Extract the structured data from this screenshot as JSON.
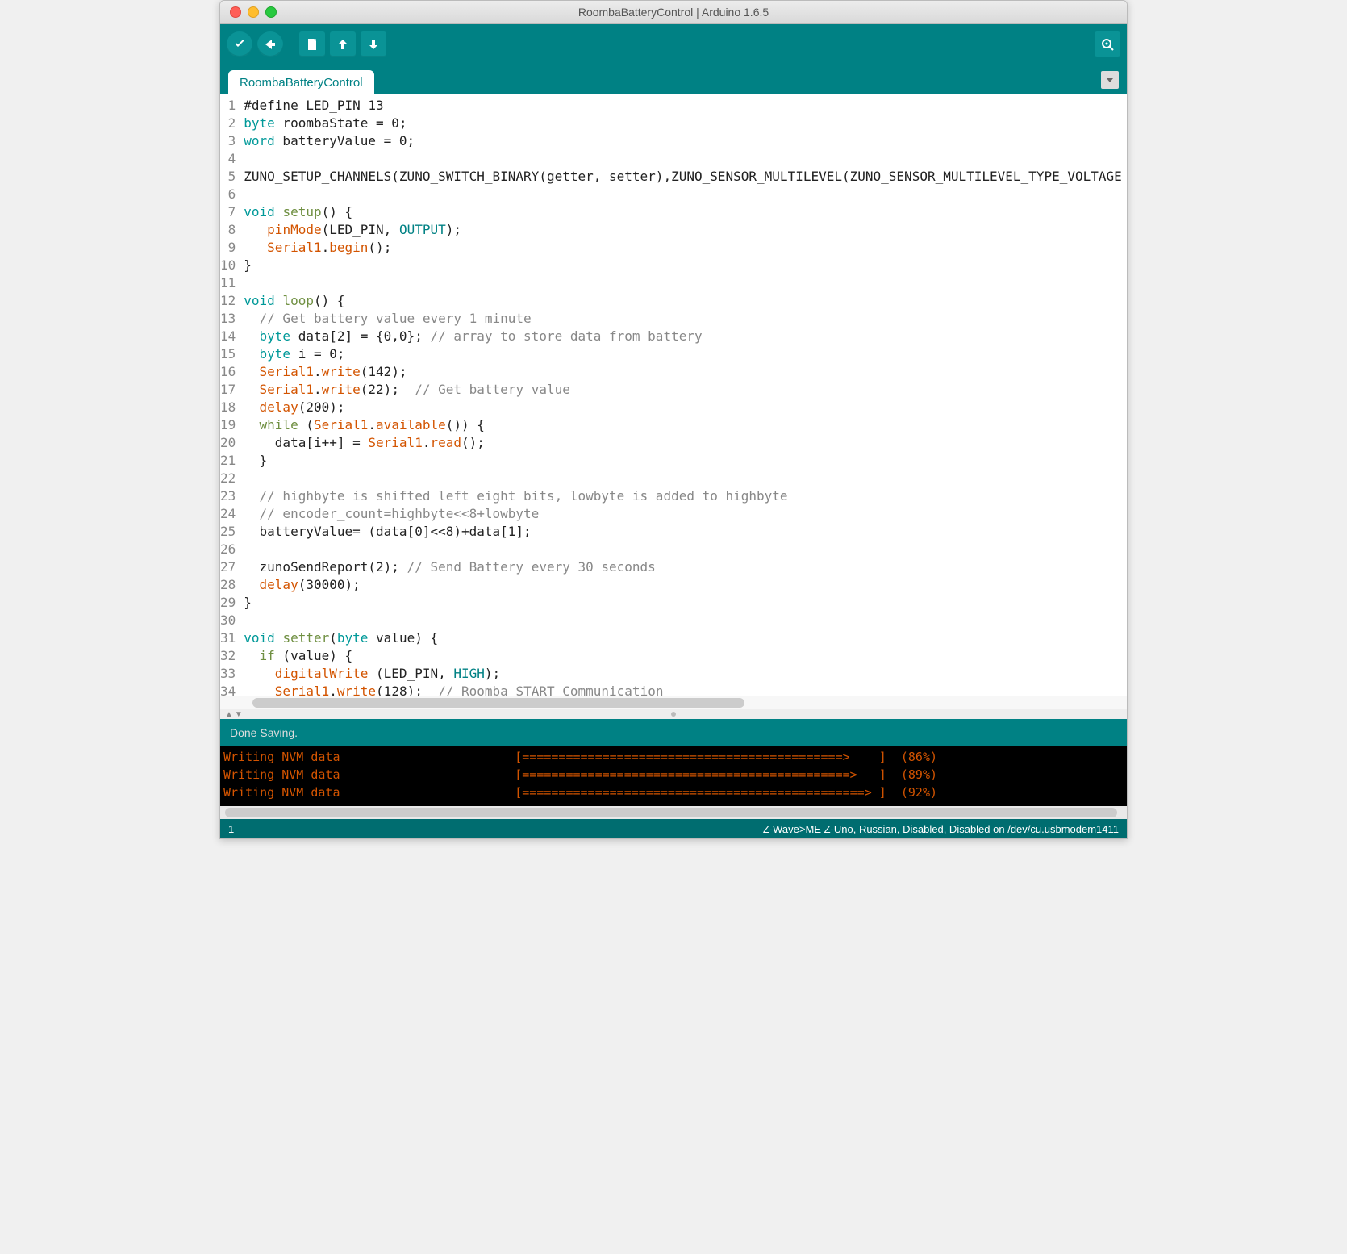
{
  "window": {
    "title": "RoombaBatteryControl | Arduino 1.6.5"
  },
  "tab": {
    "name": "RoombaBatteryControl"
  },
  "status": {
    "message": "Done Saving."
  },
  "footer": {
    "line": "1",
    "board": "Z-Wave>ME Z-Uno, Russian, Disabled, Disabled on /dev/cu.usbmodem1411"
  },
  "code_lines": [
    {
      "n": 1,
      "tokens": [
        [
          "#define LED_PIN 13",
          ""
        ]
      ]
    },
    {
      "n": 2,
      "tokens": [
        [
          "byte",
          "kw-teal"
        ],
        [
          " roombaState = 0;",
          ""
        ]
      ]
    },
    {
      "n": 3,
      "tokens": [
        [
          "word",
          "kw-teal"
        ],
        [
          " batteryValue = 0;",
          ""
        ]
      ]
    },
    {
      "n": 4,
      "tokens": [
        [
          "",
          ""
        ]
      ]
    },
    {
      "n": 5,
      "tokens": [
        [
          "ZUNO_SETUP_CHANNELS(ZUNO_SWITCH_BINARY(getter, setter),ZUNO_SENSOR_MULTILEVEL(ZUNO_SENSOR_MULTILEVEL_TYPE_VOLTAGE",
          ""
        ]
      ]
    },
    {
      "n": 6,
      "tokens": [
        [
          "",
          ""
        ]
      ]
    },
    {
      "n": 7,
      "tokens": [
        [
          "void",
          "kw-teal"
        ],
        [
          " ",
          ""
        ],
        [
          "setup",
          "kw-green"
        ],
        [
          "() {",
          ""
        ]
      ]
    },
    {
      "n": 8,
      "tokens": [
        [
          "   ",
          ""
        ],
        [
          "pinMode",
          "kw-orange"
        ],
        [
          "(LED_PIN, ",
          ""
        ],
        [
          "OUTPUT",
          "const"
        ],
        [
          ");",
          ""
        ]
      ]
    },
    {
      "n": 9,
      "tokens": [
        [
          "   ",
          ""
        ],
        [
          "Serial1",
          "kw-orange"
        ],
        [
          ".",
          ""
        ],
        [
          "begin",
          "kw-orange"
        ],
        [
          "();",
          ""
        ]
      ]
    },
    {
      "n": 10,
      "tokens": [
        [
          "}",
          ""
        ]
      ]
    },
    {
      "n": 11,
      "tokens": [
        [
          "",
          ""
        ]
      ]
    },
    {
      "n": 12,
      "tokens": [
        [
          "void",
          "kw-teal"
        ],
        [
          " ",
          ""
        ],
        [
          "loop",
          "kw-green"
        ],
        [
          "() {",
          ""
        ]
      ]
    },
    {
      "n": 13,
      "tokens": [
        [
          "  ",
          ""
        ],
        [
          "// Get battery value every 1 minute",
          "comment"
        ]
      ]
    },
    {
      "n": 14,
      "tokens": [
        [
          "  ",
          ""
        ],
        [
          "byte",
          "kw-teal"
        ],
        [
          " data[2] = {0,0}; ",
          ""
        ],
        [
          "// array to store data from battery",
          "comment"
        ]
      ]
    },
    {
      "n": 15,
      "tokens": [
        [
          "  ",
          ""
        ],
        [
          "byte",
          "kw-teal"
        ],
        [
          " i = 0;",
          ""
        ]
      ]
    },
    {
      "n": 16,
      "tokens": [
        [
          "  ",
          ""
        ],
        [
          "Serial1",
          "kw-orange"
        ],
        [
          ".",
          ""
        ],
        [
          "write",
          "kw-orange"
        ],
        [
          "(142);",
          ""
        ]
      ]
    },
    {
      "n": 17,
      "tokens": [
        [
          "  ",
          ""
        ],
        [
          "Serial1",
          "kw-orange"
        ],
        [
          ".",
          ""
        ],
        [
          "write",
          "kw-orange"
        ],
        [
          "(22);  ",
          ""
        ],
        [
          "// Get battery value",
          "comment"
        ]
      ]
    },
    {
      "n": 18,
      "tokens": [
        [
          "  ",
          ""
        ],
        [
          "delay",
          "kw-orange"
        ],
        [
          "(200);",
          ""
        ]
      ]
    },
    {
      "n": 19,
      "tokens": [
        [
          "  ",
          ""
        ],
        [
          "while",
          "kw-green"
        ],
        [
          " (",
          ""
        ],
        [
          "Serial1",
          "kw-orange"
        ],
        [
          ".",
          ""
        ],
        [
          "available",
          "kw-orange"
        ],
        [
          "()) {",
          ""
        ]
      ]
    },
    {
      "n": 20,
      "tokens": [
        [
          "    data[i++] = ",
          ""
        ],
        [
          "Serial1",
          "kw-orange"
        ],
        [
          ".",
          ""
        ],
        [
          "read",
          "kw-orange"
        ],
        [
          "();",
          ""
        ]
      ]
    },
    {
      "n": 21,
      "tokens": [
        [
          "  }",
          ""
        ]
      ]
    },
    {
      "n": 22,
      "tokens": [
        [
          "",
          ""
        ]
      ]
    },
    {
      "n": 23,
      "tokens": [
        [
          "  ",
          ""
        ],
        [
          "// highbyte is shifted left eight bits, lowbyte is added to highbyte",
          "comment"
        ]
      ]
    },
    {
      "n": 24,
      "tokens": [
        [
          "  ",
          ""
        ],
        [
          "// encoder_count=highbyte<<8+lowbyte",
          "comment"
        ]
      ]
    },
    {
      "n": 25,
      "tokens": [
        [
          "  batteryValue= (data[0]<<8)+data[1];",
          ""
        ]
      ]
    },
    {
      "n": 26,
      "tokens": [
        [
          "",
          ""
        ]
      ]
    },
    {
      "n": 27,
      "tokens": [
        [
          "  zunoSendReport(2); ",
          ""
        ],
        [
          "// Send Battery every 30 seconds",
          "comment"
        ]
      ]
    },
    {
      "n": 28,
      "tokens": [
        [
          "  ",
          ""
        ],
        [
          "delay",
          "kw-orange"
        ],
        [
          "(30000);",
          ""
        ]
      ]
    },
    {
      "n": 29,
      "tokens": [
        [
          "}",
          ""
        ]
      ]
    },
    {
      "n": 30,
      "tokens": [
        [
          "",
          ""
        ]
      ]
    },
    {
      "n": 31,
      "tokens": [
        [
          "void",
          "kw-teal"
        ],
        [
          " ",
          ""
        ],
        [
          "setter",
          "kw-green"
        ],
        [
          "(",
          ""
        ],
        [
          "byte",
          "kw-teal"
        ],
        [
          " value) {",
          ""
        ]
      ]
    },
    {
      "n": 32,
      "tokens": [
        [
          "  ",
          ""
        ],
        [
          "if",
          "kw-green"
        ],
        [
          " (value) {",
          ""
        ]
      ]
    },
    {
      "n": 33,
      "tokens": [
        [
          "    ",
          ""
        ],
        [
          "digitalWrite",
          "kw-orange"
        ],
        [
          " (LED_PIN, ",
          ""
        ],
        [
          "HIGH",
          "const"
        ],
        [
          ");",
          ""
        ]
      ]
    },
    {
      "n": 34,
      "tokens": [
        [
          "    ",
          ""
        ],
        [
          "Serial1",
          "kw-orange"
        ],
        [
          ".",
          ""
        ],
        [
          "write",
          "kw-orange"
        ],
        [
          "(128);  ",
          ""
        ],
        [
          "// Roomba START Communication",
          "comment"
        ]
      ]
    }
  ],
  "console_lines": [
    {
      "label": "Writing NVM data",
      "bar": "[============================================>    ]",
      "pct": "(86%)"
    },
    {
      "label": "Writing NVM data",
      "bar": "[=============================================>   ]",
      "pct": "(89%)"
    },
    {
      "label": "Writing NVM data",
      "bar": "[===============================================> ]",
      "pct": "(92%)"
    }
  ]
}
